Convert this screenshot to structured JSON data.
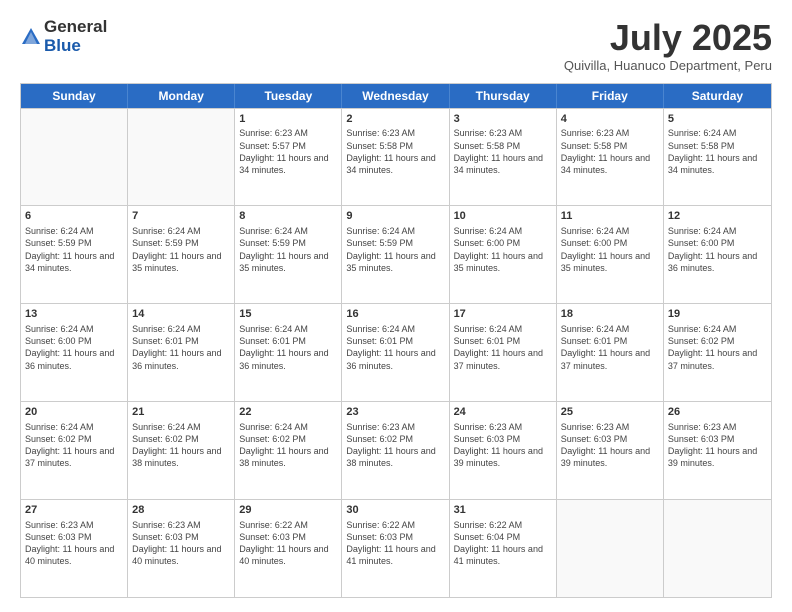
{
  "logo": {
    "general": "General",
    "blue": "Blue"
  },
  "title": "July 2025",
  "subtitle": "Quivilla, Huanuco Department, Peru",
  "header": {
    "days": [
      "Sunday",
      "Monday",
      "Tuesday",
      "Wednesday",
      "Thursday",
      "Friday",
      "Saturday"
    ]
  },
  "weeks": [
    [
      {
        "day": "",
        "sunrise": "",
        "sunset": "",
        "daylight": ""
      },
      {
        "day": "",
        "sunrise": "",
        "sunset": "",
        "daylight": ""
      },
      {
        "day": "1",
        "sunrise": "Sunrise: 6:23 AM",
        "sunset": "Sunset: 5:57 PM",
        "daylight": "Daylight: 11 hours and 34 minutes."
      },
      {
        "day": "2",
        "sunrise": "Sunrise: 6:23 AM",
        "sunset": "Sunset: 5:58 PM",
        "daylight": "Daylight: 11 hours and 34 minutes."
      },
      {
        "day": "3",
        "sunrise": "Sunrise: 6:23 AM",
        "sunset": "Sunset: 5:58 PM",
        "daylight": "Daylight: 11 hours and 34 minutes."
      },
      {
        "day": "4",
        "sunrise": "Sunrise: 6:23 AM",
        "sunset": "Sunset: 5:58 PM",
        "daylight": "Daylight: 11 hours and 34 minutes."
      },
      {
        "day": "5",
        "sunrise": "Sunrise: 6:24 AM",
        "sunset": "Sunset: 5:58 PM",
        "daylight": "Daylight: 11 hours and 34 minutes."
      }
    ],
    [
      {
        "day": "6",
        "sunrise": "Sunrise: 6:24 AM",
        "sunset": "Sunset: 5:59 PM",
        "daylight": "Daylight: 11 hours and 34 minutes."
      },
      {
        "day": "7",
        "sunrise": "Sunrise: 6:24 AM",
        "sunset": "Sunset: 5:59 PM",
        "daylight": "Daylight: 11 hours and 35 minutes."
      },
      {
        "day": "8",
        "sunrise": "Sunrise: 6:24 AM",
        "sunset": "Sunset: 5:59 PM",
        "daylight": "Daylight: 11 hours and 35 minutes."
      },
      {
        "day": "9",
        "sunrise": "Sunrise: 6:24 AM",
        "sunset": "Sunset: 5:59 PM",
        "daylight": "Daylight: 11 hours and 35 minutes."
      },
      {
        "day": "10",
        "sunrise": "Sunrise: 6:24 AM",
        "sunset": "Sunset: 6:00 PM",
        "daylight": "Daylight: 11 hours and 35 minutes."
      },
      {
        "day": "11",
        "sunrise": "Sunrise: 6:24 AM",
        "sunset": "Sunset: 6:00 PM",
        "daylight": "Daylight: 11 hours and 35 minutes."
      },
      {
        "day": "12",
        "sunrise": "Sunrise: 6:24 AM",
        "sunset": "Sunset: 6:00 PM",
        "daylight": "Daylight: 11 hours and 36 minutes."
      }
    ],
    [
      {
        "day": "13",
        "sunrise": "Sunrise: 6:24 AM",
        "sunset": "Sunset: 6:00 PM",
        "daylight": "Daylight: 11 hours and 36 minutes."
      },
      {
        "day": "14",
        "sunrise": "Sunrise: 6:24 AM",
        "sunset": "Sunset: 6:01 PM",
        "daylight": "Daylight: 11 hours and 36 minutes."
      },
      {
        "day": "15",
        "sunrise": "Sunrise: 6:24 AM",
        "sunset": "Sunset: 6:01 PM",
        "daylight": "Daylight: 11 hours and 36 minutes."
      },
      {
        "day": "16",
        "sunrise": "Sunrise: 6:24 AM",
        "sunset": "Sunset: 6:01 PM",
        "daylight": "Daylight: 11 hours and 36 minutes."
      },
      {
        "day": "17",
        "sunrise": "Sunrise: 6:24 AM",
        "sunset": "Sunset: 6:01 PM",
        "daylight": "Daylight: 11 hours and 37 minutes."
      },
      {
        "day": "18",
        "sunrise": "Sunrise: 6:24 AM",
        "sunset": "Sunset: 6:01 PM",
        "daylight": "Daylight: 11 hours and 37 minutes."
      },
      {
        "day": "19",
        "sunrise": "Sunrise: 6:24 AM",
        "sunset": "Sunset: 6:02 PM",
        "daylight": "Daylight: 11 hours and 37 minutes."
      }
    ],
    [
      {
        "day": "20",
        "sunrise": "Sunrise: 6:24 AM",
        "sunset": "Sunset: 6:02 PM",
        "daylight": "Daylight: 11 hours and 37 minutes."
      },
      {
        "day": "21",
        "sunrise": "Sunrise: 6:24 AM",
        "sunset": "Sunset: 6:02 PM",
        "daylight": "Daylight: 11 hours and 38 minutes."
      },
      {
        "day": "22",
        "sunrise": "Sunrise: 6:24 AM",
        "sunset": "Sunset: 6:02 PM",
        "daylight": "Daylight: 11 hours and 38 minutes."
      },
      {
        "day": "23",
        "sunrise": "Sunrise: 6:23 AM",
        "sunset": "Sunset: 6:02 PM",
        "daylight": "Daylight: 11 hours and 38 minutes."
      },
      {
        "day": "24",
        "sunrise": "Sunrise: 6:23 AM",
        "sunset": "Sunset: 6:03 PM",
        "daylight": "Daylight: 11 hours and 39 minutes."
      },
      {
        "day": "25",
        "sunrise": "Sunrise: 6:23 AM",
        "sunset": "Sunset: 6:03 PM",
        "daylight": "Daylight: 11 hours and 39 minutes."
      },
      {
        "day": "26",
        "sunrise": "Sunrise: 6:23 AM",
        "sunset": "Sunset: 6:03 PM",
        "daylight": "Daylight: 11 hours and 39 minutes."
      }
    ],
    [
      {
        "day": "27",
        "sunrise": "Sunrise: 6:23 AM",
        "sunset": "Sunset: 6:03 PM",
        "daylight": "Daylight: 11 hours and 40 minutes."
      },
      {
        "day": "28",
        "sunrise": "Sunrise: 6:23 AM",
        "sunset": "Sunset: 6:03 PM",
        "daylight": "Daylight: 11 hours and 40 minutes."
      },
      {
        "day": "29",
        "sunrise": "Sunrise: 6:22 AM",
        "sunset": "Sunset: 6:03 PM",
        "daylight": "Daylight: 11 hours and 40 minutes."
      },
      {
        "day": "30",
        "sunrise": "Sunrise: 6:22 AM",
        "sunset": "Sunset: 6:03 PM",
        "daylight": "Daylight: 11 hours and 41 minutes."
      },
      {
        "day": "31",
        "sunrise": "Sunrise: 6:22 AM",
        "sunset": "Sunset: 6:04 PM",
        "daylight": "Daylight: 11 hours and 41 minutes."
      },
      {
        "day": "",
        "sunrise": "",
        "sunset": "",
        "daylight": ""
      },
      {
        "day": "",
        "sunrise": "",
        "sunset": "",
        "daylight": ""
      }
    ]
  ]
}
